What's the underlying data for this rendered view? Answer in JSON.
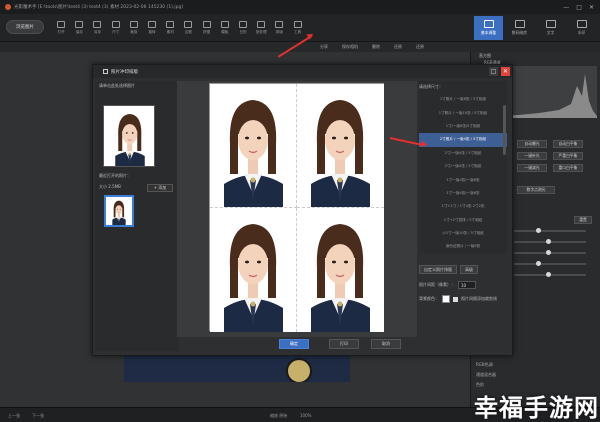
{
  "app": {
    "title": "光影魔术手 [E:\\tools\\图片\\test4 (3) test4 (3) 素材 2023-02-06 145230 (1).jpg]",
    "window_controls": [
      "—",
      "□",
      "✕"
    ],
    "open_button": "浏览图片"
  },
  "toolbar": {
    "tools": [
      "打开",
      "保存",
      "另存",
      "尺寸",
      "裁剪",
      "旋转",
      "素材",
      "边框",
      "拼图",
      "模板",
      "日历",
      "批处理",
      "排版",
      "工具"
    ],
    "right_tabs": [
      {
        "label": "基本调整",
        "icon": "adjust-icon",
        "active": true
      },
      {
        "label": "数码暗房",
        "icon": "darkroom-icon",
        "active": false
      },
      {
        "label": "文字",
        "icon": "text-icon",
        "active": false
      },
      {
        "label": "水印",
        "icon": "watermark-icon",
        "active": false
      }
    ]
  },
  "subbar": {
    "items": [
      "分享",
      "保存相机",
      "删除",
      "还原",
      "还原"
    ]
  },
  "right_panel": {
    "histogram_label": "直方图",
    "channel_label": "RGB通道",
    "auto_buttons": [
      "自动曝光",
      "自动白平衡",
      "一键补光",
      "严重白平衡",
      "一键减光",
      "重口白平衡"
    ],
    "one_click": "数字点测光",
    "slider_header": "重置",
    "sliders": [
      0.3,
      0.45,
      0.45,
      0.3,
      0.45
    ],
    "list_below": [
      "RGB色调",
      "通道混合器",
      "色阶"
    ]
  },
  "dialog": {
    "title": "照片冲印排版",
    "source_label": "请单击此处选择图片",
    "recent_label": "最近打开的照片：",
    "count_label": "大小 2.5MB",
    "add_button": "+ 添加",
    "size_header": "请选择尺寸：",
    "sizes": [
      "1寸照片 / 一版8张 / 5寸相纸",
      "1寸照片 / 一版10张 / 5寸相纸",
      "1寸/一版8张/5寸相纸",
      "2寸照片 / 一版4张 / 5寸相纸",
      "2寸/一版4张 / 5寸相纸",
      "2寸/一版4张 / 5寸相纸",
      "1寸一版4张/一版6张",
      "1寸一版4张/一版8张",
      "1寸+2寸 / 1寸4张 2寸2张",
      "1寸+2寸混排 / 5寸相纸",
      "小1寸一版10张 / 5寸相纸",
      "身份证照片 / 一版8张",
      "驾照 / 一版8张 / 5寸相纸",
      "护照 / 一版6张 / 5寸相纸"
    ],
    "selected_size_index": 3,
    "custom_button": "自定义照片排版",
    "pro_button": "高级",
    "spacing_label": "照片间距（像素）：",
    "spacing_value": "10",
    "bgcolor_label": "背景颜色：",
    "check_label": "照片间隔添加裁剪线",
    "footer": [
      "确定",
      "打印",
      "取消"
    ]
  },
  "status": {
    "items": [
      "上一张",
      "下一张",
      "缩放 原始",
      "100%"
    ]
  },
  "watermark": "幸福手游网",
  "colors": {
    "accent": "#3c6fc1",
    "arrow": "#e03030",
    "close": "#e0443b"
  }
}
